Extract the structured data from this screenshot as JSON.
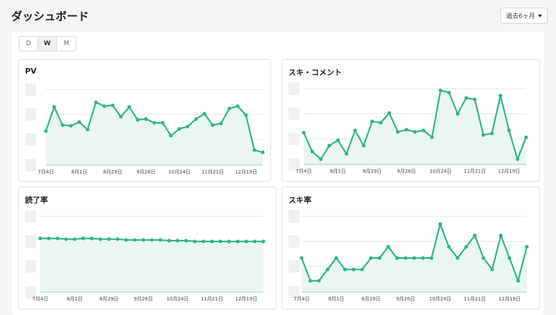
{
  "header": {
    "title": "ダッシュボード",
    "range_label": "過去6ヶ月"
  },
  "period_tabs": [
    {
      "label": "D"
    },
    {
      "label": "W"
    },
    {
      "label": "M"
    }
  ],
  "active_period": "W",
  "colors": {
    "accent": "#2db38c",
    "fill": "#e9f6f1"
  },
  "chart_data": [
    {
      "type": "area",
      "title": "PV",
      "x_tick_labels": [
        "7月4日",
        "8月1日",
        "8月29日",
        "9月26日",
        "10月24日",
        "11月21日",
        "12月19日"
      ],
      "values": [
        45,
        77,
        53,
        52,
        57,
        47,
        83,
        78,
        79,
        64,
        77,
        60,
        61,
        56,
        56,
        39,
        48,
        51,
        61,
        68,
        53,
        55,
        75,
        78,
        66,
        20,
        17
      ],
      "ylim": [
        0,
        100
      ]
    },
    {
      "type": "area",
      "title": "スキ・コメント",
      "x_tick_labels": [
        "7月4日",
        "8月1日",
        "8月29日",
        "9月26日",
        "10月24日",
        "11月21日",
        "12月19日"
      ],
      "values": [
        42,
        17,
        7,
        25,
        32,
        14,
        45,
        25,
        57,
        55,
        68,
        43,
        46,
        43,
        45,
        36,
        98,
        95,
        67,
        88,
        86,
        39,
        41,
        91,
        45,
        7,
        36
      ],
      "ylim": [
        0,
        100
      ]
    },
    {
      "type": "area",
      "title": "読了率",
      "x_tick_labels": [
        "7月4日",
        "8月1日",
        "8月29日",
        "9月26日",
        "10月24日",
        "11月21日",
        "12月19日"
      ],
      "values": [
        71,
        71,
        71,
        70,
        70,
        71,
        71,
        70,
        70,
        70,
        69,
        69,
        69,
        69,
        69,
        68,
        68,
        68,
        67,
        67,
        67,
        67,
        67,
        67,
        67,
        67,
        67
      ],
      "ylim": [
        0,
        100
      ]
    },
    {
      "type": "area",
      "title": "スキ率",
      "x_tick_labels": [
        "7月4日",
        "8月1日",
        "8月29日",
        "9月26日",
        "10月24日",
        "11月21日",
        "12月19日"
      ],
      "values": [
        45,
        15,
        15,
        30,
        45,
        30,
        30,
        30,
        45,
        45,
        60,
        45,
        45,
        45,
        45,
        45,
        90,
        60,
        45,
        60,
        75,
        45,
        30,
        75,
        45,
        15,
        60
      ],
      "ylim": [
        0,
        100
      ]
    }
  ]
}
